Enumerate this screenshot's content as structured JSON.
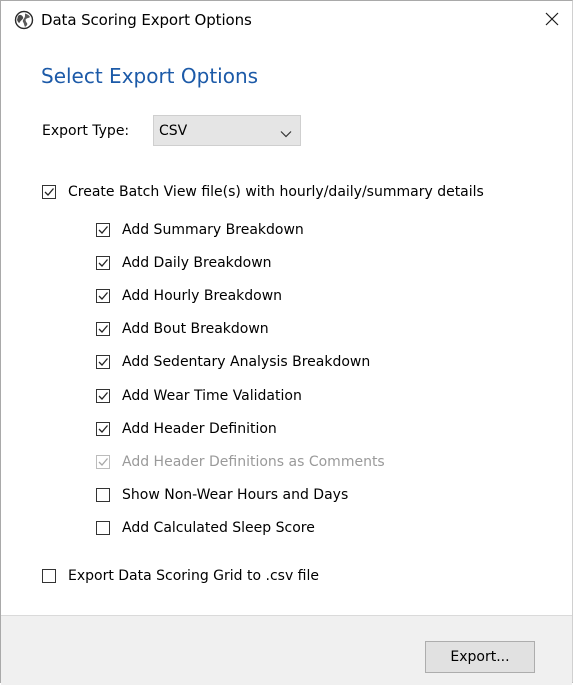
{
  "window": {
    "title": "Data Scoring Export Options",
    "close_glyph": "✕"
  },
  "heading": "Select Export Options",
  "export_type": {
    "label": "Export Type:",
    "selected": "CSV"
  },
  "batch": {
    "label": "Create Batch View file(s) with hourly/daily/summary details",
    "checked": true
  },
  "options": [
    {
      "label": "Add Summary Breakdown",
      "checked": true,
      "disabled": false
    },
    {
      "label": "Add Daily Breakdown",
      "checked": true,
      "disabled": false
    },
    {
      "label": "Add Hourly Breakdown",
      "checked": true,
      "disabled": false
    },
    {
      "label": "Add Bout Breakdown",
      "checked": true,
      "disabled": false
    },
    {
      "label": "Add Sedentary Analysis Breakdown",
      "checked": true,
      "disabled": false
    },
    {
      "label": "Add Wear Time Validation",
      "checked": true,
      "disabled": false
    },
    {
      "label": "Add Header Definition",
      "checked": true,
      "disabled": false
    },
    {
      "label": "Add Header Definitions as Comments",
      "checked": true,
      "disabled": true
    },
    {
      "label": "Show Non-Wear Hours and Days",
      "checked": false,
      "disabled": false
    },
    {
      "label": "Add Calculated Sleep Score",
      "checked": false,
      "disabled": false
    }
  ],
  "grid_export": {
    "label": "Export Data Scoring Grid to .csv file",
    "checked": false
  },
  "export_button": "Export...",
  "colors": {
    "heading": "#1c5aa8",
    "footer_bg": "#f0f0f0",
    "select_bg": "#e5e5e5"
  }
}
